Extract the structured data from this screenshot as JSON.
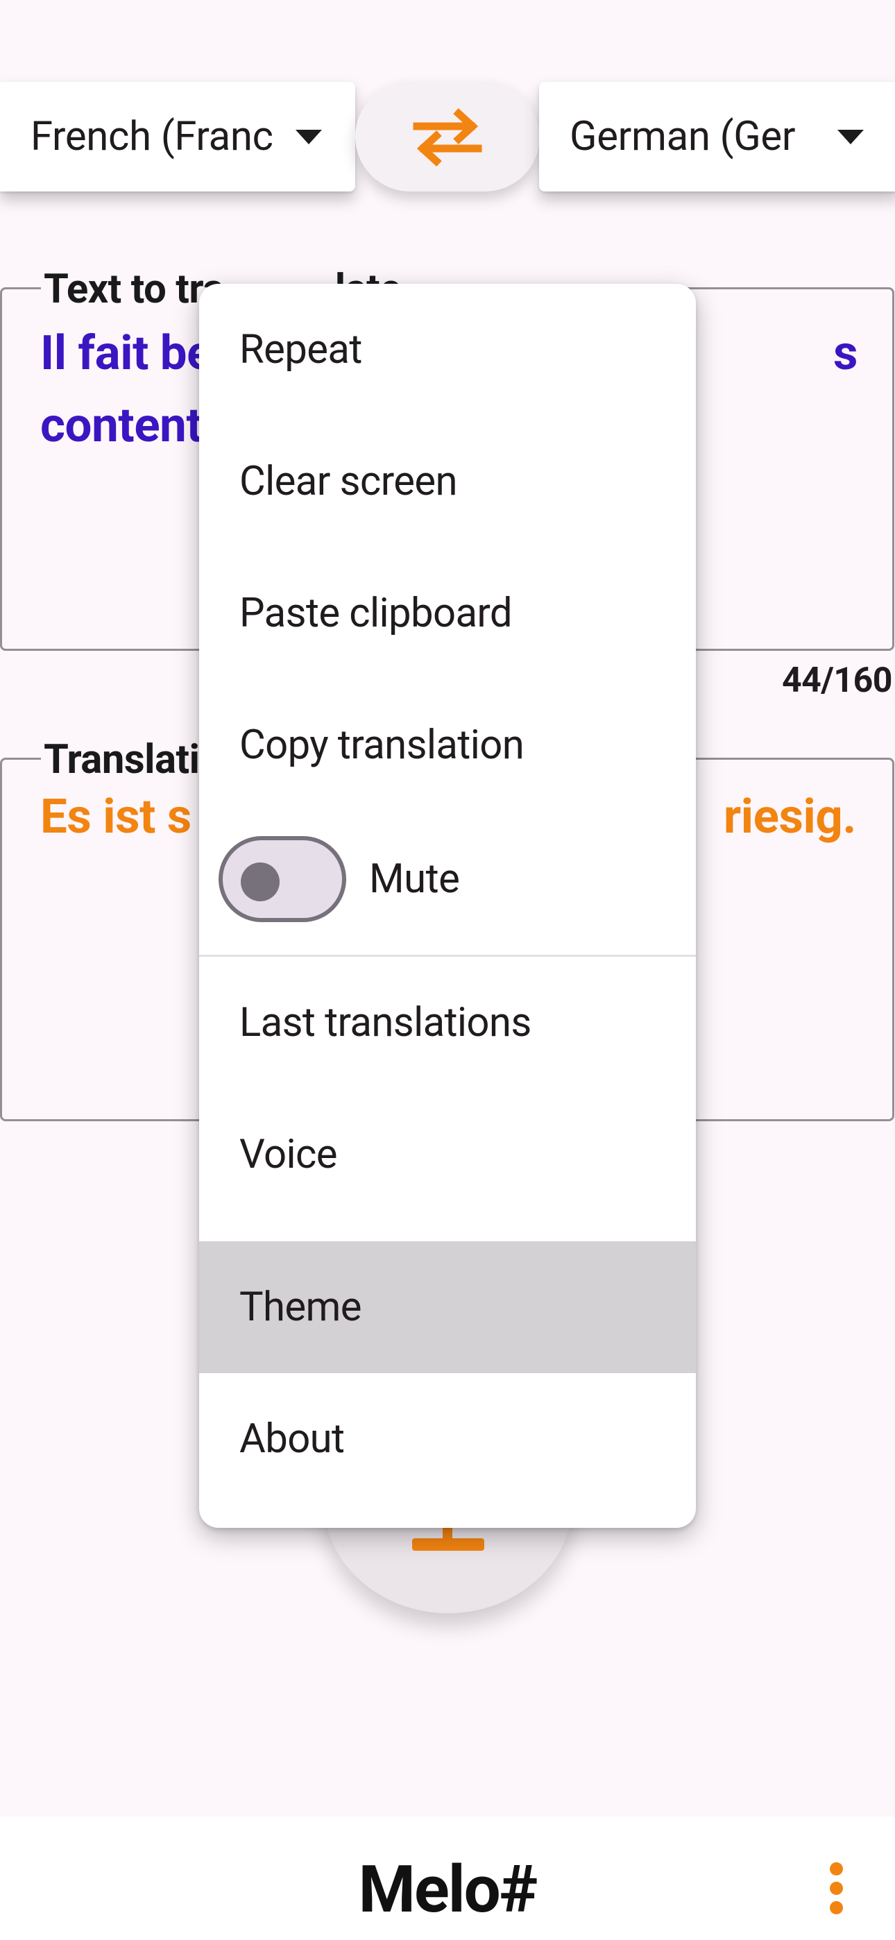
{
  "colors": {
    "accent": "#f28411",
    "source_text": "#3a16c2",
    "highlight": "#d4d1d4",
    "background": "#fdf7fb"
  },
  "language_bar": {
    "from_language": "French (Franc",
    "to_language": "German (Ger",
    "swap_icon": "swap-arrows-icon"
  },
  "source": {
    "label": "Text to tra",
    "label_tail": "late",
    "text_line1": "Il fait be",
    "text_line1_tail": "s",
    "text_line2": "content",
    "char_count": "44/160"
  },
  "translation": {
    "label": "Translati",
    "text": "Es ist s",
    "text_tail": "riesig."
  },
  "menu": {
    "items": [
      {
        "label": "Repeat"
      },
      {
        "label": "Clear screen"
      },
      {
        "label": "Paste clipboard"
      },
      {
        "label": "Copy translation"
      }
    ],
    "mute": {
      "label": "Mute",
      "on": false
    },
    "items_after_divider": [
      {
        "label": "Last translations"
      },
      {
        "label": "Voice"
      },
      {
        "label": "Theme",
        "highlighted": true
      },
      {
        "label": "About"
      }
    ]
  },
  "bottom_bar": {
    "title": "Melo#",
    "more_icon": "more-vert-icon"
  }
}
